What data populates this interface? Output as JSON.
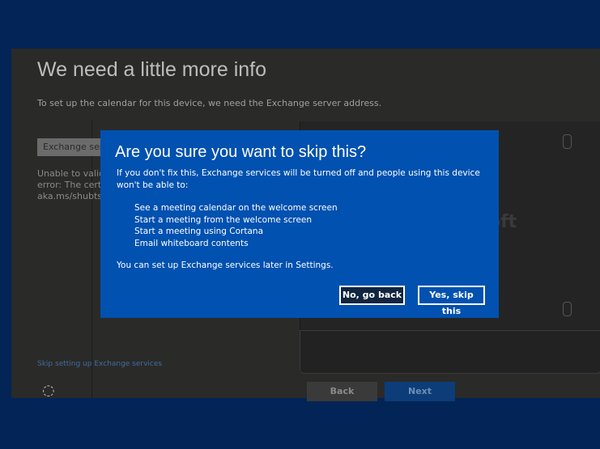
{
  "page": {
    "title": "We need a little more info",
    "subtitle": "To set up the calendar for this device, we need the Exchange server address.",
    "input_value": "Exchange server",
    "error_lines": [
      "Unable to validate",
      "error: The certificate",
      "aka.ms/shubtshoot"
    ],
    "skip_link": "Skip setting up Exchange services",
    "back_label": "Back",
    "next_label": "Next",
    "logo_text": "Microsoft"
  },
  "dialog": {
    "title": "Are you sure you want to skip this?",
    "body": "If you don't fix this, Exchange services will be turned off and people using this device won't be able to:",
    "items": [
      "See a meeting calendar on the welcome screen",
      "Start a meeting from the welcome screen",
      "Start a meeting using Cortana",
      "Email whiteboard contents"
    ],
    "footer": "You can set up Exchange services later in Settings.",
    "no_label": "No, go back",
    "yes_label": "Yes, skip this"
  }
}
